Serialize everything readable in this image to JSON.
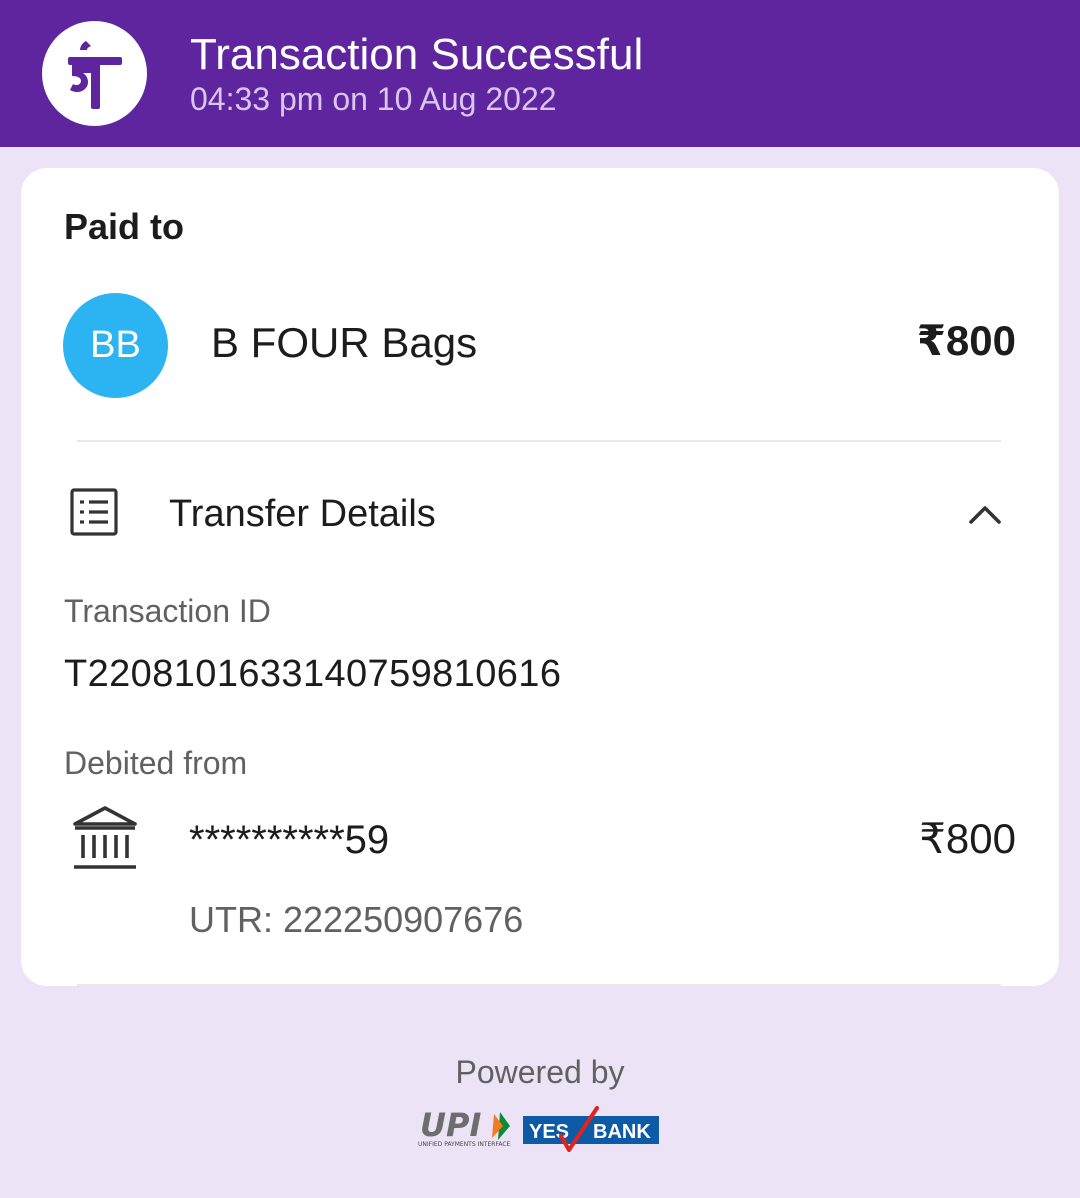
{
  "header": {
    "title": "Transaction Successful",
    "subtitle": "04:33 pm on 10 Aug 2022",
    "logo_icon": "phonepe-logo-icon",
    "logo_glyph": "पे"
  },
  "payee": {
    "section_label": "Paid to",
    "initials": "BB",
    "name": "B FOUR Bags",
    "amount": "₹800",
    "avatar_color": "#2cb4f2"
  },
  "transfer_details": {
    "label": "Transfer Details",
    "icon": "receipt-list-icon",
    "toggle_icon": "chevron-up-icon",
    "transaction_id_label": "Transaction ID",
    "transaction_id": "T2208101633140759810616",
    "debited_from_label": "Debited from",
    "bank_icon": "bank-icon",
    "account_masked": "**********59",
    "debited_amount": "₹800",
    "utr": "UTR: 222250907676"
  },
  "footer": {
    "powered_by": "Powered by",
    "upi_logo_text": "UPI",
    "upi_tagline": "UNIFIED PAYMENTS INTERFACE",
    "bank_logo_text_1": "YES",
    "bank_logo_text_2": "BANK"
  },
  "colors": {
    "brand_purple": "#5f259f",
    "page_background": "#ede3f6",
    "yes_bank_blue": "#0d5aa7",
    "yes_bank_red": "#e2231a"
  }
}
